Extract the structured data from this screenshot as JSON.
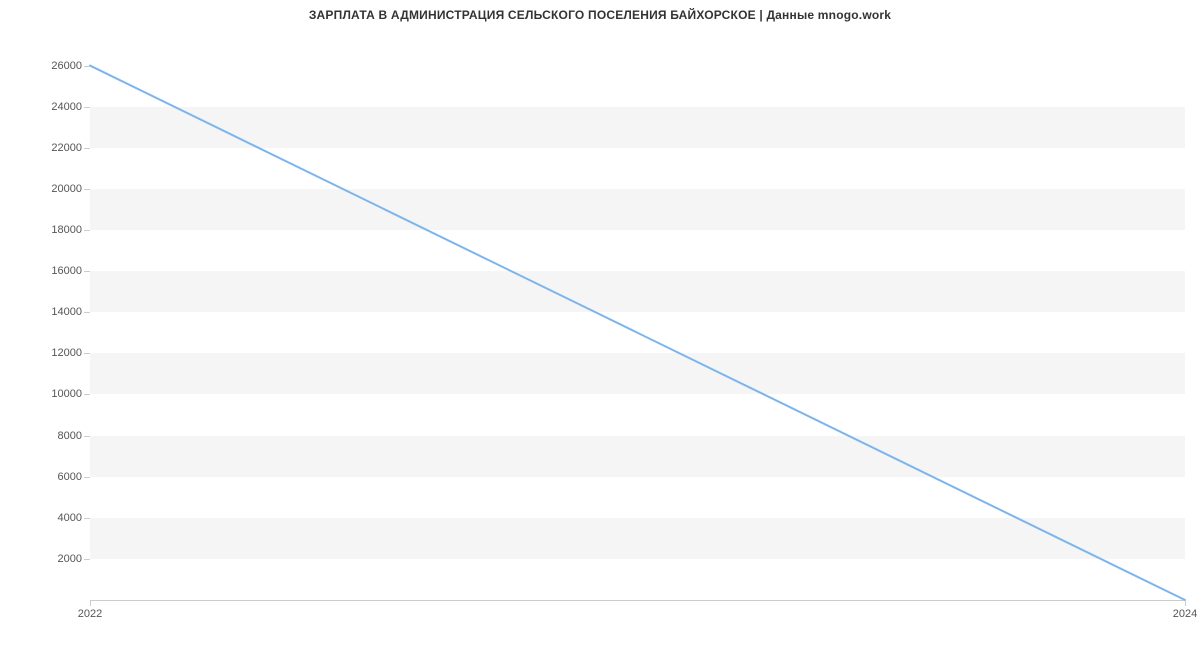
{
  "chart_data": {
    "type": "line",
    "title": "ЗАРПЛАТА В АДМИНИСТРАЦИЯ СЕЛЬСКОГО ПОСЕЛЕНИЯ БАЙХОРСКОЕ | Данные mnogo.work",
    "x": [
      2022,
      2024
    ],
    "values": [
      26000,
      0
    ],
    "x_ticks": [
      2022,
      2024
    ],
    "y_ticks": [
      2000,
      4000,
      6000,
      8000,
      10000,
      12000,
      14000,
      16000,
      18000,
      20000,
      22000,
      24000,
      26000
    ],
    "xlim": [
      2022,
      2024
    ],
    "ylim": [
      0,
      27000
    ],
    "line_color": "#7cb5ec",
    "band_color": "#f5f5f5"
  }
}
